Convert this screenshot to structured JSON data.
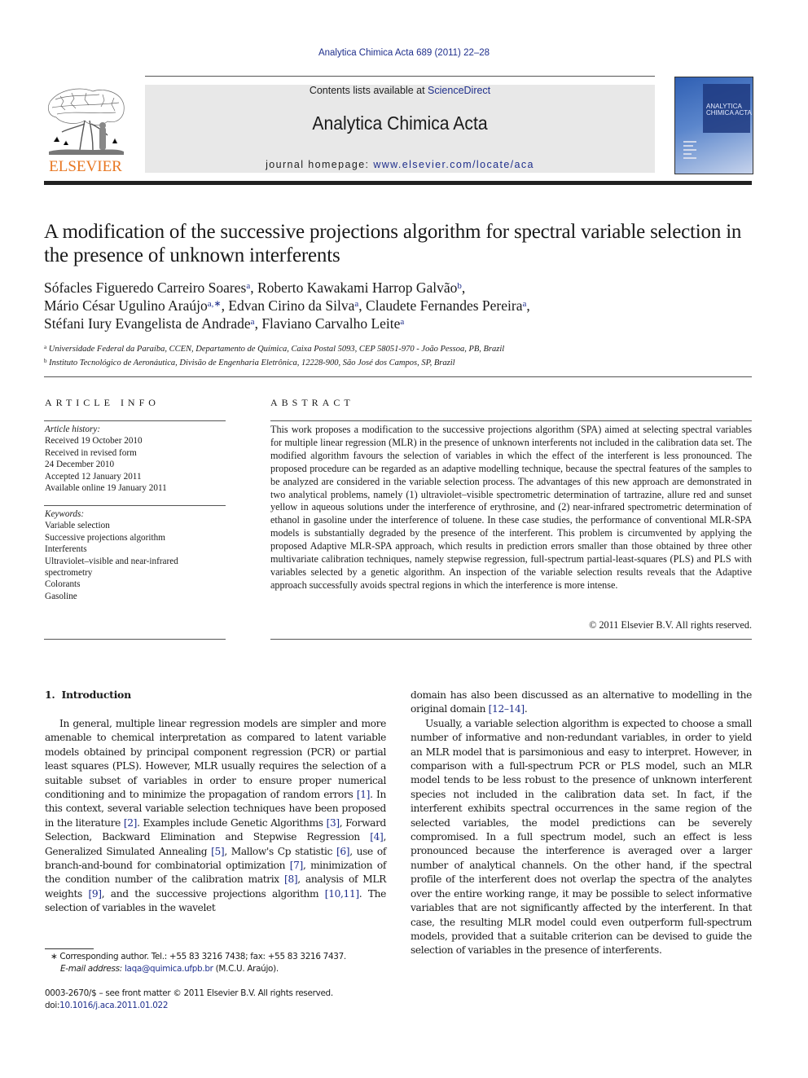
{
  "running_head": "Analytica Chimica Acta 689 (2011) 22–28",
  "header": {
    "publisher_logo_text": "ELSEVIER",
    "contents_prefix": "Contents lists available at ",
    "contents_link": "ScienceDirect",
    "journal_name": "Analytica Chimica Acta",
    "homepage_prefix": "journal homepage: ",
    "homepage_link": "www.elsevier.com/locate/aca",
    "cover_title_line1": "ANALYTICA",
    "cover_title_line2": "CHIMICA ACTA"
  },
  "article": {
    "title": "A modification of the successive projections algorithm for spectral variable selection in the presence of unknown interferents",
    "authors": [
      {
        "name": "Sófacles Figueredo Carreiro Soares",
        "sup": "a",
        "sep": ", "
      },
      {
        "name": "Roberto Kawakami Harrop Galvão",
        "sup": "b",
        "sep": ","
      },
      {
        "name": "Mário César Ugulino Araújo",
        "sup": "a,∗",
        "sep": ", "
      },
      {
        "name": "Edvan Cirino da Silva",
        "sup": "a",
        "sep": ", "
      },
      {
        "name": "Claudete Fernandes Pereira",
        "sup": "a",
        "sep": ","
      },
      {
        "name": "Stéfani Iury Evangelista de Andrade",
        "sup": "a",
        "sep": ", "
      },
      {
        "name": "Flaviano Carvalho Leite",
        "sup": "a",
        "sep": ""
      }
    ],
    "affiliations": [
      {
        "sup": "a",
        "text": "Universidade Federal da Paraíba, CCEN, Departamento de Química, Caixa Postal 5093, CEP 58051-970 - João Pessoa, PB, Brazil"
      },
      {
        "sup": "b",
        "text": "Instituto Tecnológico de Aeronáutica, Divisão de Engenharia Eletrônica, 12228-900, São José dos Campos, SP, Brazil"
      }
    ]
  },
  "article_info": {
    "heading": "ARTICLE INFO",
    "history_label": "Article history:",
    "history": [
      "Received 19 October 2010",
      "Received in revised form",
      "24 December 2010",
      "Accepted 12 January 2011",
      "Available online 19 January 2011"
    ],
    "keywords_label": "Keywords:",
    "keywords": [
      "Variable selection",
      "Successive projections algorithm",
      "Interferents",
      "Ultraviolet–visible and near-infrared",
      "spectrometry",
      "Colorants",
      "Gasoline"
    ]
  },
  "abstract": {
    "heading": "ABSTRACT",
    "text": "This work proposes a modification to the successive projections algorithm (SPA) aimed at selecting spectral variables for multiple linear regression (MLR) in the presence of unknown interferents not included in the calibration data set. The modified algorithm favours the selection of variables in which the effect of the interferent is less pronounced. The proposed procedure can be regarded as an adaptive modelling technique, because the spectral features of the samples to be analyzed are considered in the variable selection process. The advantages of this new approach are demonstrated in two analytical problems, namely (1) ultraviolet–visible spectrometric determination of tartrazine, allure red and sunset yellow in aqueous solutions under the interference of erythrosine, and (2) near-infrared spectrometric determination of ethanol in gasoline under the interference of toluene. In these case studies, the performance of conventional MLR-SPA models is substantially degraded by the presence of the interferent. This problem is circumvented by applying the proposed Adaptive MLR-SPA approach, which results in prediction errors smaller than those obtained by three other multivariate calibration techniques, namely stepwise regression, full-spectrum partial-least-squares (PLS) and PLS with variables selected by a genetic algorithm. An inspection of the variable selection results reveals that the Adaptive approach successfully avoids spectral regions in which the interference is more intense.",
    "copyright": "© 2011 Elsevier B.V. All rights reserved."
  },
  "introduction": {
    "number": "1.",
    "heading": "Introduction",
    "left_paragraph": [
      {
        "t": "In general, multiple linear regression models are simpler and more amenable to chemical interpretation as compared to latent variable models obtained by principal component regression (PCR) or partial least squares (PLS). However, MLR usually requires the selection of a suitable subset of variables in order to ensure proper numerical conditioning and to minimize the propagation of random errors "
      },
      {
        "ref": "[1]"
      },
      {
        "t": ". In this context, several variable selection techniques have been proposed in the literature "
      },
      {
        "ref": "[2]"
      },
      {
        "t": ". Examples include Genetic Algorithms "
      },
      {
        "ref": "[3]"
      },
      {
        "t": ", Forward Selection, Backward Elimination and Stepwise Regression "
      },
      {
        "ref": "[4]"
      },
      {
        "t": ", Generalized Simulated Annealing "
      },
      {
        "ref": "[5]"
      },
      {
        "t": ", Mallow's Cp statistic "
      },
      {
        "ref": "[6]"
      },
      {
        "t": ", use of branch-and-bound for combinatorial optimization "
      },
      {
        "ref": "[7]"
      },
      {
        "t": ", minimization of the condition number of the calibration matrix "
      },
      {
        "ref": "[8]"
      },
      {
        "t": ", analysis of MLR weights "
      },
      {
        "ref": "[9]"
      },
      {
        "t": ", and the successive projections algorithm "
      },
      {
        "ref": "[10,11]"
      },
      {
        "t": ". The selection of variables in the wavelet"
      }
    ],
    "right_continuation": [
      {
        "t": "domain has also been discussed as an alternative to modelling in the original domain "
      },
      {
        "ref": "[12–14]"
      },
      {
        "t": "."
      }
    ],
    "right_paragraph": "Usually, a variable selection algorithm is expected to choose a small number of informative and non-redundant variables, in order to yield an MLR model that is parsimonious and easy to interpret. However, in comparison with a full-spectrum PCR or PLS model, such an MLR model tends to be less robust to the presence of unknown interferent species not included in the calibration data set. In fact, if the interferent exhibits spectral occurrences in the same region of the selected variables, the model predictions can be severely compromised. In a full spectrum model, such an effect is less pronounced because the interference is averaged over a larger number of analytical channels. On the other hand, if the spectral profile of the interferent does not overlap the spectra of the analytes over the entire working range, it may be possible to select informative variables that are not significantly affected by the interferent. In that case, the resulting MLR model could even outperform full-spectrum models, provided that a suitable criterion can be devised to guide the selection of variables in the presence of interferents."
  },
  "footnote": {
    "marker": "∗",
    "corresponding": "Corresponding author. Tel.: +55 83 3216 7438; fax: +55 83 3216 7437.",
    "email_label": "E-mail address:",
    "email": "laqa@quimica.ufpb.br",
    "email_suffix": " (M.C.U. Araújo)."
  },
  "front_matter": {
    "issn_line": "0003-2670/$ – see front matter © 2011 Elsevier B.V. All rights reserved.",
    "doi_prefix": "doi:",
    "doi": "10.1016/j.aca.2011.01.022"
  },
  "colors": {
    "link": "#1f2f8c",
    "elsevier_orange": "#e87722",
    "banner_bg": "#e8e8e8"
  }
}
